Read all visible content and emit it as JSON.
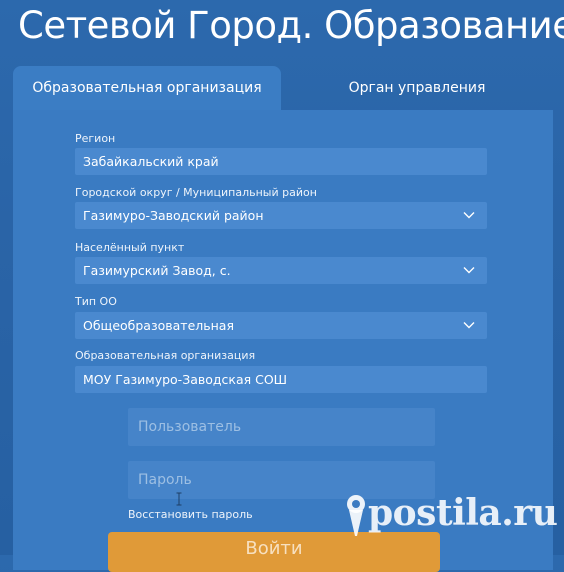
{
  "app": {
    "title": "Сетевой Город. Образование"
  },
  "tabs": [
    {
      "label": "Образовательная организация",
      "active": true
    },
    {
      "label": "Орган управления",
      "active": false
    }
  ],
  "form": {
    "region": {
      "label": "Регион",
      "value": "Забайкальский край"
    },
    "district": {
      "label": "Городской округ / Муниципальный район",
      "value": "Газимуро-Заводский район"
    },
    "locality": {
      "label": "Населённый пункт",
      "value": "Газимурский Завод, с."
    },
    "org_type": {
      "label": "Тип ОО",
      "value": "Общеобразовательная"
    },
    "organization": {
      "label": "Образовательная организация",
      "value": "МОУ Газимуро-Заводская СОШ"
    }
  },
  "login": {
    "username_placeholder": "Пользователь",
    "password_placeholder": "Пароль",
    "restore_link": "Восстановить пароль",
    "submit_label": "Войти"
  },
  "watermark": {
    "text": "postila.ru",
    "icon": "pin-icon"
  },
  "colors": {
    "background": "#2c69ad",
    "panel": "#3a7bc2",
    "field": "#4a89cf",
    "button": "#e09a38"
  }
}
